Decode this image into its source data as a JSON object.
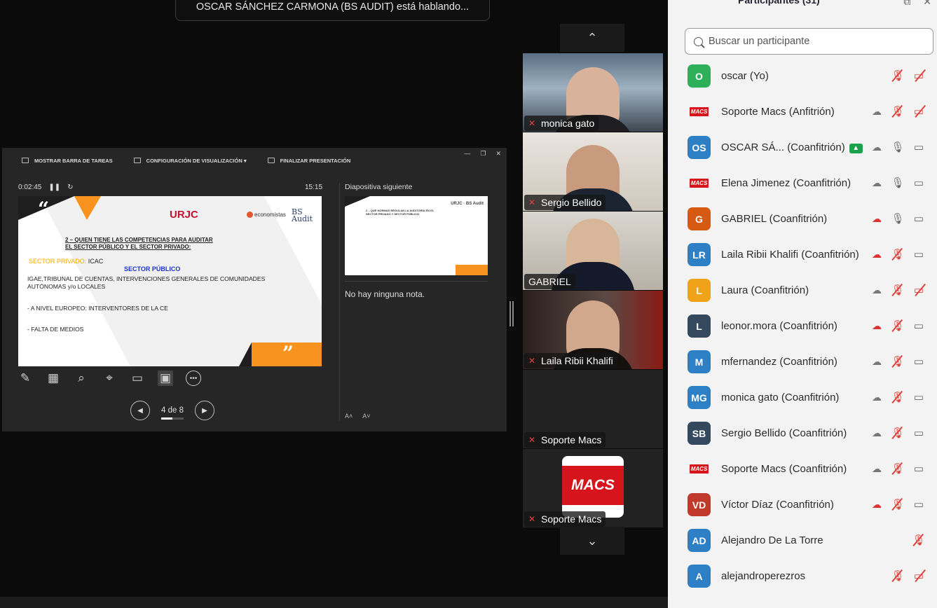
{
  "banner": {
    "speaking": "OSCAR SÁNCHEZ CARMONA (BS AUDIT) está hablando..."
  },
  "presenter": {
    "topbar": {
      "show_taskbar": "MOSTRAR BARRA DE TAREAS",
      "display_settings": "CONFIGURACIÓN DE VISUALIZACIÓN ▾",
      "end_presentation": "FINALIZAR PRESENTACIÓN"
    },
    "elapsed": "0:02:45",
    "clock": "15:15",
    "next_slide_label": "Diapositiva siguiente",
    "notes": "No hay ninguna nota.",
    "page_indicator": "4 de 8",
    "slide": {
      "logo_urjc": "URJC",
      "logo_eco": "economistas",
      "logo_bs": "BS Audit",
      "title_line1": "2 – QUIEN TIENE LAS COMPETENCIAS PARA AUDITAR",
      "title_line2": "EL SECTOR PÚBLICO Y EL SECTOR PRIVADO:",
      "private_label": "SECTOR PRIVADO:",
      "private_value": " ICAC",
      "public_label": "SECTOR PÚBLICO",
      "line1a": "IGAE,TRIBUNAL DE CUENTAS, INTERVENCIONES GENERALES DE COMUNIDADES",
      "line1b": "AUTÓNOMAS y/o LOCALES",
      "line2": "- A NIVEL EUROPEO: INTERVENTORES DE LA CE",
      "line3": "- FALTA DE MEDIOS"
    },
    "next_slide": {
      "text1": "2 – QUE NORMAS REGULAN LA AUDITORÍA EN EL",
      "text2": "SECTOR PRIVADO Y SECTOR PÚBLICO",
      "logo": "URJC · BS Audit"
    }
  },
  "videos": [
    {
      "name": "monica gato",
      "muted": true
    },
    {
      "name": "Sergio Bellido",
      "muted": true
    },
    {
      "name": "GABRIEL",
      "muted": false
    },
    {
      "name": "Laila Ribii Khalifi",
      "muted": true
    },
    {
      "name": "Soporte Macs",
      "muted": true
    },
    {
      "name": "Soporte Macs",
      "muted": true,
      "logo": "MACS"
    }
  ],
  "panel": {
    "title": "Participantes (31)",
    "search_placeholder": "Buscar un participante",
    "participants": [
      {
        "initials": "O",
        "color": "#2eaf5a",
        "name": "oscar (Yo)",
        "cloud": false,
        "mic": "off",
        "cam": "off"
      },
      {
        "initials": "MACS",
        "logo": true,
        "name": "Soporte Macs (Anfitrión)",
        "cloud": "plain",
        "mic": "off",
        "cam": "off"
      },
      {
        "initials": "OS",
        "color": "#2d7fc6",
        "name": "OSCAR SÁ... (Coanfitrión)",
        "share": true,
        "cloud": "plain",
        "mic": "on",
        "cam": "on"
      },
      {
        "initials": "MACS",
        "logo": true,
        "name": "Elena Jimenez (Coanfitrión)",
        "cloud": "plain",
        "mic": "on",
        "cam": "on"
      },
      {
        "initials": "G",
        "color": "#d65a12",
        "name": "GABRIEL (Coanfitrión)",
        "cloud": "rec",
        "mic": "on",
        "cam": "on"
      },
      {
        "initials": "LR",
        "color": "#2d7fc6",
        "name": "Laila Ribii Khalifi (Coanfitrión)",
        "cloud": "rec",
        "mic": "off",
        "cam": "on"
      },
      {
        "initials": "L",
        "color": "#f0a218",
        "name": "Laura (Coanfitrión)",
        "cloud": "plain",
        "mic": "off",
        "cam": "off"
      },
      {
        "initials": "L",
        "color": "#34495e",
        "name": "leonor.mora (Coanfitrión)",
        "cloud": "rec",
        "mic": "off",
        "cam": "on"
      },
      {
        "initials": "M",
        "color": "#2d7fc6",
        "name": "mfernandez (Coanfitrión)",
        "cloud": "plain",
        "mic": "off",
        "cam": "on"
      },
      {
        "initials": "MG",
        "color": "#2d7fc6",
        "name": "monica gato (Coanfitrión)",
        "cloud": "plain",
        "mic": "off",
        "cam": "on"
      },
      {
        "initials": "SB",
        "color": "#34495e",
        "name": "Sergio Bellido (Coanfitrión)",
        "cloud": "plain",
        "mic": "off",
        "cam": "on"
      },
      {
        "initials": "MACS",
        "logo": true,
        "name": "Soporte Macs (Coanfitrión)",
        "cloud": "plain",
        "mic": "off",
        "cam": "on"
      },
      {
        "initials": "VD",
        "color": "#c0392b",
        "name": "Víctor Díaz (Coanfitrión)",
        "cloud": "rec",
        "mic": "off",
        "cam": "on"
      },
      {
        "initials": "AD",
        "color": "#2d7fc6",
        "name": "Alejandro De La Torre",
        "cloud": false,
        "mic": false,
        "cam": "off-mic"
      },
      {
        "initials": "A",
        "color": "#2d7fc6",
        "name": "alejandroperezros",
        "cloud": false,
        "mic": "off",
        "cam": "off"
      }
    ]
  }
}
